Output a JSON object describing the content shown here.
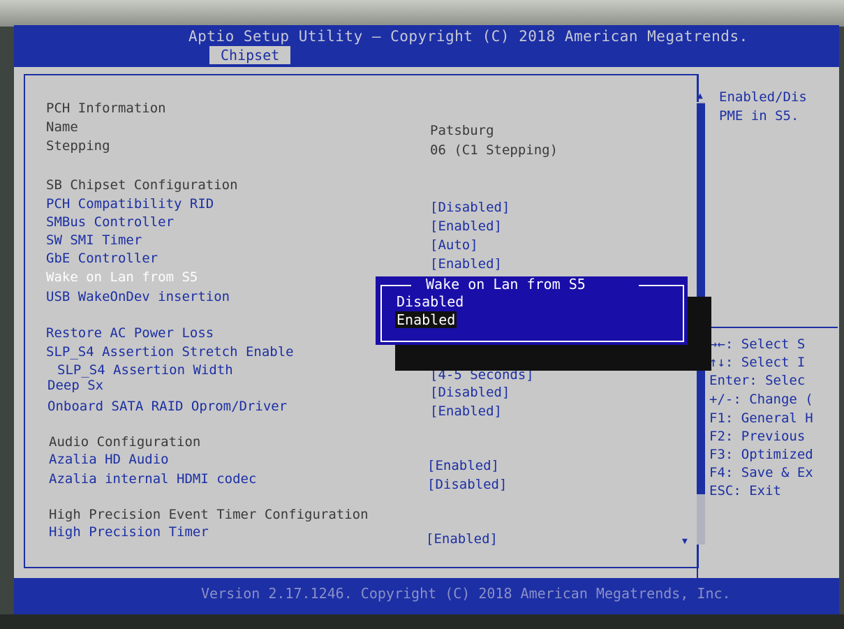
{
  "header": {
    "title": "Aptio Setup Utility – Copyright (C) 2018 American Megatrends.",
    "active_tab": "Chipset"
  },
  "main": {
    "pch_info": {
      "heading": "PCH Information",
      "name_label": "Name",
      "name_value": "Patsburg",
      "stepping_label": "Stepping",
      "stepping_value": "06 (C1 Stepping)"
    },
    "sb_config": {
      "heading": "SB Chipset Configuration",
      "items": [
        {
          "label": "PCH Compatibility RID",
          "value": "[Disabled]"
        },
        {
          "label": "SMBus Controller",
          "value": "[Enabled]"
        },
        {
          "label": "SW SMI Timer",
          "value": "[Auto]"
        },
        {
          "label": "GbE Controller",
          "value": "[Enabled]"
        },
        {
          "label": "Wake on Lan from S5",
          "value": ""
        },
        {
          "label": "USB WakeOnDev insertion",
          "value": ""
        }
      ]
    },
    "power": {
      "items": [
        {
          "label": "Restore AC Power Loss",
          "value": ""
        },
        {
          "label": "SLP_S4 Assertion Stretch Enable",
          "value": ""
        },
        {
          "label": "SLP_S4 Assertion Width",
          "value": "[4-5 Seconds]"
        },
        {
          "label": "Deep Sx",
          "value": "[Disabled]"
        },
        {
          "label": "Onboard SATA RAID Oprom/Driver",
          "value": "[Enabled]"
        }
      ]
    },
    "audio": {
      "heading": "Audio Configuration",
      "items": [
        {
          "label": "Azalia HD Audio",
          "value": "[Enabled]"
        },
        {
          "label": "Azalia internal HDMI codec",
          "value": "[Disabled]"
        }
      ]
    },
    "hpet": {
      "heading": "High Precision Event Timer Configuration",
      "items": [
        {
          "label": "High Precision Timer",
          "value": "[Enabled]"
        }
      ]
    }
  },
  "sidebar": {
    "help_line1": "Enabled/Dis",
    "help_line2": "PME in S5.",
    "keys": [
      "→←: Select S",
      "↑↓: Select I",
      "Enter: Selec",
      "+/-: Change (",
      "F1: General H",
      "F2: Previous",
      "F3: Optimized",
      "F4: Save & Ex",
      "ESC: Exit"
    ]
  },
  "popup": {
    "title": "Wake on Lan from S5",
    "options": [
      "Disabled",
      "Enabled"
    ],
    "selected": "Enabled"
  },
  "footer": {
    "text": "Version 2.17.1246. Copyright (C) 2018 American Megatrends, Inc."
  },
  "colors": {
    "bios_blue": "#1c2fa4",
    "popup_blue": "#1a0ea8",
    "background_gray": "#c8c8c8"
  }
}
